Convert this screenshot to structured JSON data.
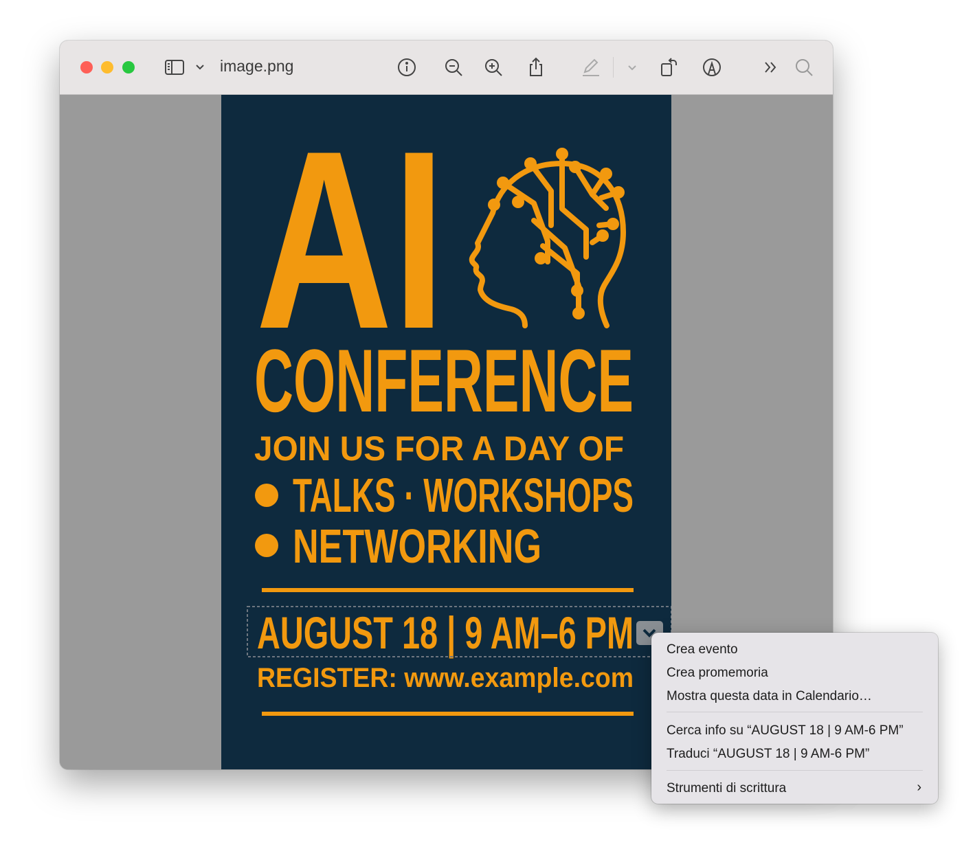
{
  "window": {
    "title": "image.png"
  },
  "toolbar": {
    "icons": [
      "sidebar-icon",
      "chevron-down-icon",
      "info-icon",
      "zoom-out-icon",
      "zoom-in-icon",
      "share-icon",
      "markup-pen-icon",
      "chevron-down-icon",
      "rotate-icon",
      "annotate-icon",
      "more-icon",
      "search-icon"
    ]
  },
  "poster": {
    "headline": "AI",
    "subtitle": "CONFERENCE",
    "tagline": "JOIN US FOR A DAY OF",
    "line1": "TALKS · WORKSHOPS",
    "line2": "NETWORKING",
    "date": "AUGUST 18 | 9 AM–6 PM",
    "register": "REGISTER: www.example.com",
    "colors": {
      "background": "#0e2a3e",
      "accent": "#f2990f"
    }
  },
  "context_menu": {
    "items": [
      "Crea evento",
      "Crea promemoria",
      "Mostra questa data in Calendario…"
    ],
    "items2": [
      "Cerca info su “AUGUST 18 | 9 AM-6 PM”",
      "Traduci “AUGUST 18 | 9 AM-6 PM”"
    ],
    "submenu": "Strumenti di scrittura"
  }
}
